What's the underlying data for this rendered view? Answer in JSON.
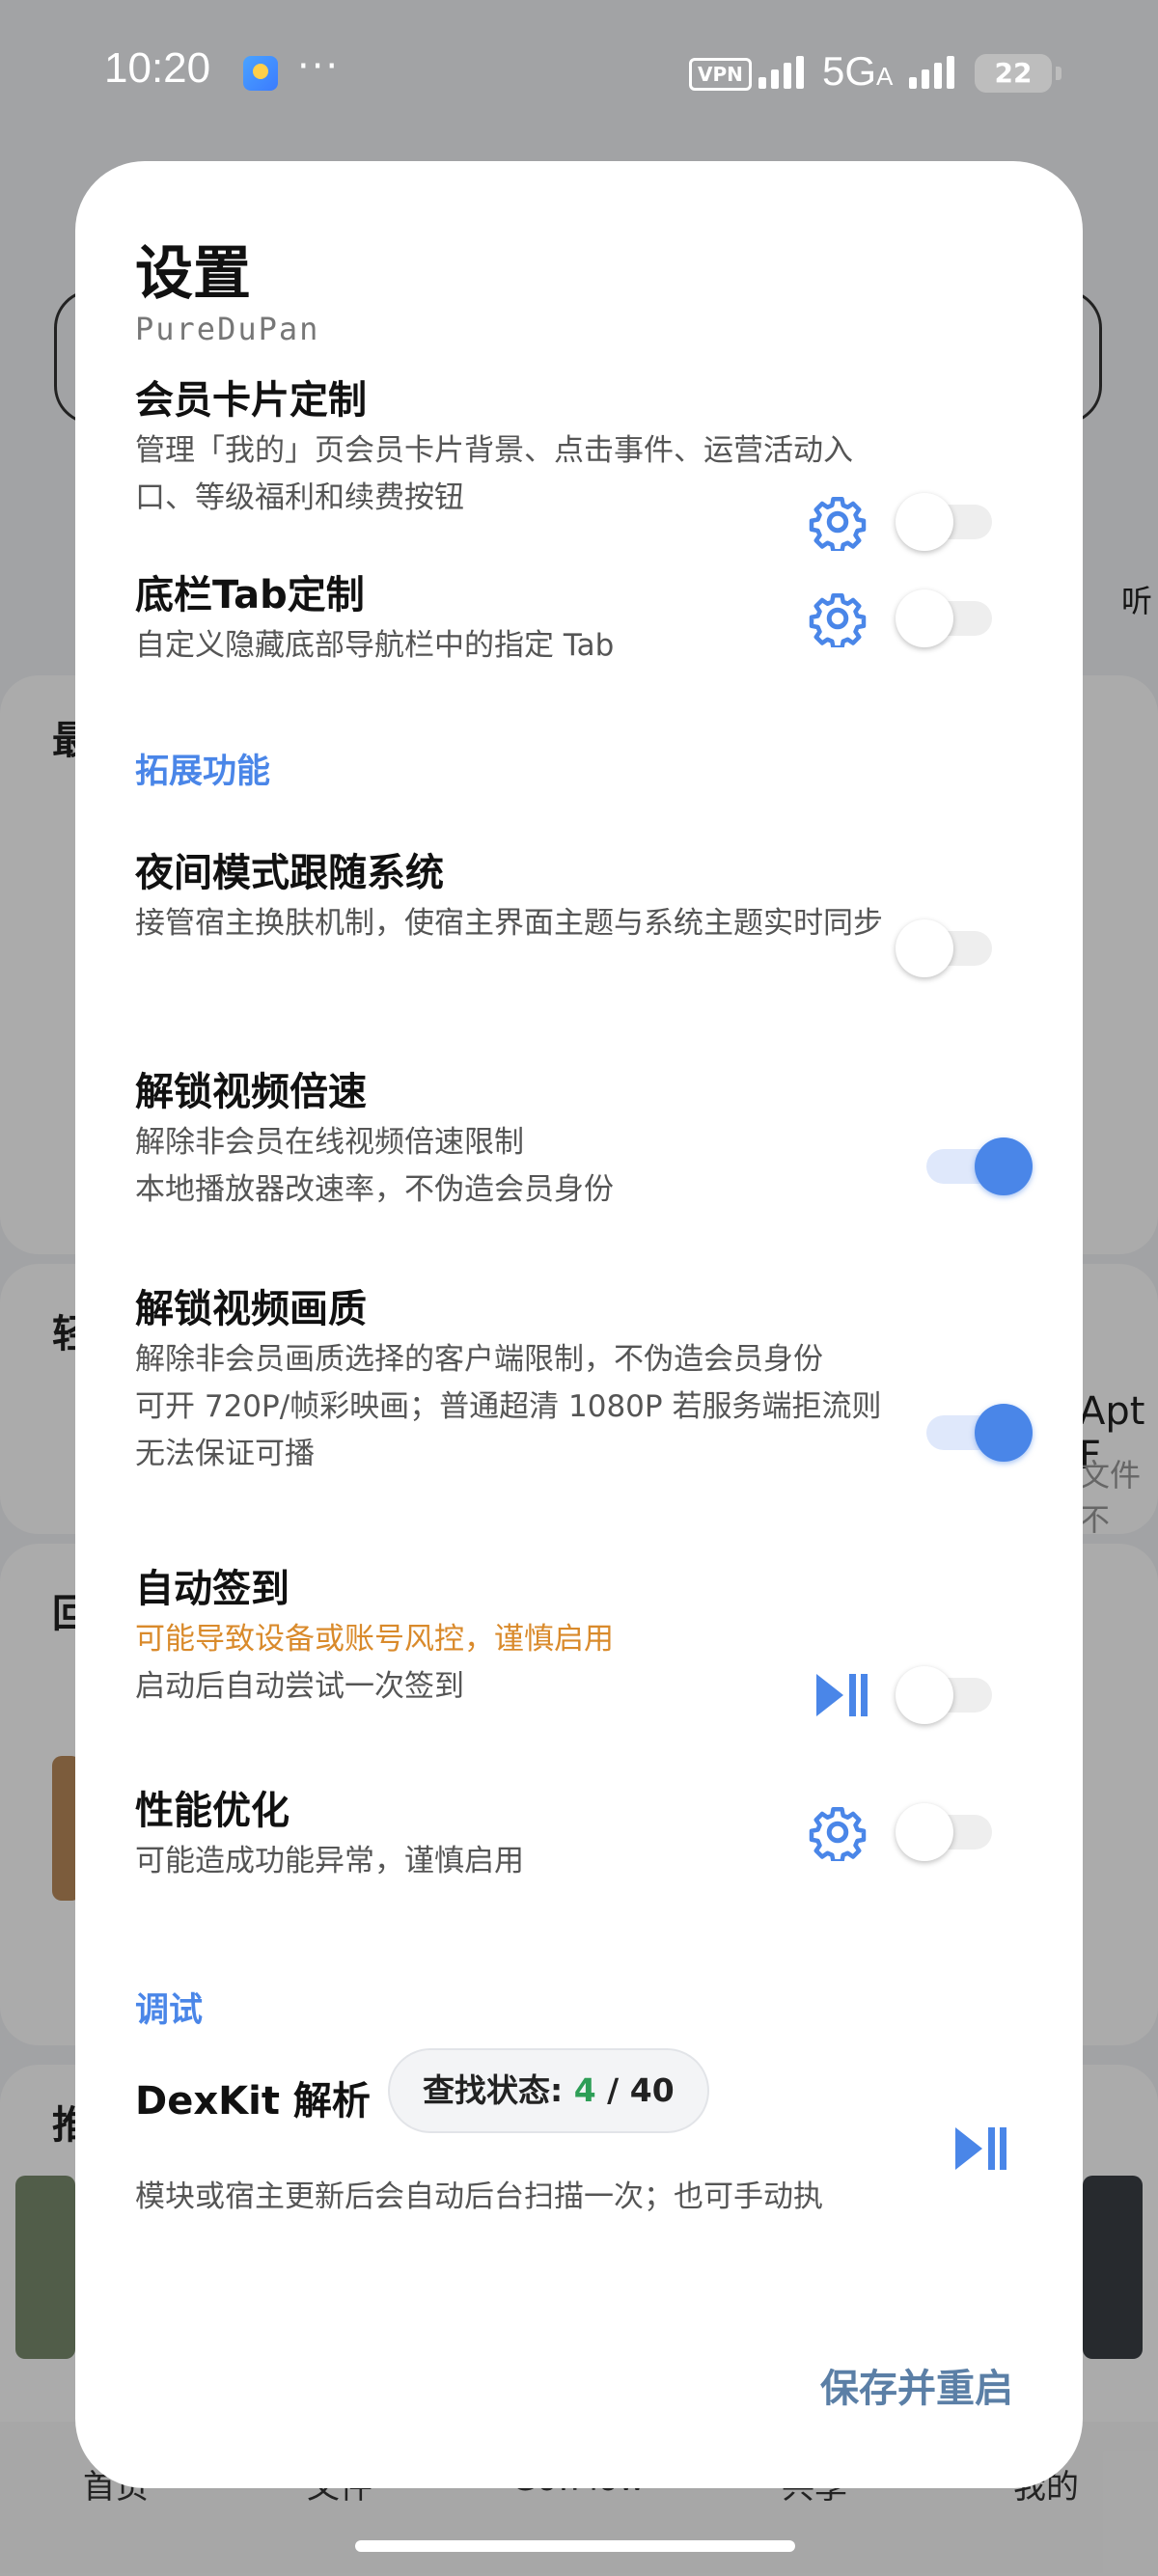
{
  "status_bar": {
    "time": "10:20",
    "dots": "···",
    "vpn": "VPN",
    "network": "5G",
    "network_sub": "A",
    "battery": "22"
  },
  "background_app": {
    "labels": [
      "最",
      "轻",
      "回",
      "推"
    ],
    "right_labels": [
      "听",
      "Apt F",
      "文件不"
    ],
    "bottom_nav": [
      "首页",
      "文件",
      "Go!Flow",
      "共享",
      "我的"
    ]
  },
  "dialog": {
    "title": "设置",
    "subtitle": "PureDuPan",
    "items": [
      {
        "title": "会员卡片定制",
        "desc": "管理「我的」页会员卡片背景、点击事件、运营活动入口、等级福利和续费按钮",
        "control_icon": "gear-icon",
        "enabled": false
      },
      {
        "title": "底栏Tab定制",
        "desc": "自定义隐藏底部导航栏中的指定 Tab",
        "control_icon": "gear-icon",
        "enabled": false
      }
    ],
    "section_extend": "拓展功能",
    "extend_items": [
      {
        "title": "夜间模式跟随系统",
        "desc": "接管宿主换肤机制，使宿主界面主题与系统主题实时同步",
        "enabled": false
      },
      {
        "title": "解锁视频倍速",
        "desc1": "解除非会员在线视频倍速限制",
        "desc2": "本地播放器改速率，不伪造会员身份",
        "enabled": true
      },
      {
        "title": "解锁视频画质",
        "desc1": "解除非会员画质选择的客户端限制，不伪造会员身份",
        "desc2": "可开 720P/帧彩映画；普通超清 1080P 若服务端拒流则无法保证可播",
        "enabled": true
      },
      {
        "title": "自动签到",
        "warning": "可能导致设备或账号风控，谨慎启用",
        "desc": "启动后自动尝试一次签到",
        "control_icon": "play-pause-icon",
        "enabled": false
      },
      {
        "title": "性能优化",
        "desc": "可能造成功能异常，谨慎启用",
        "control_icon": "gear-icon",
        "enabled": false
      }
    ],
    "section_debug": "调试",
    "dexkit": {
      "title": "DexKit 解析",
      "status_label": "查找状态:",
      "found": "4",
      "separator": "/",
      "total": "40",
      "desc": "模块或宿主更新后会自动后台扫描一次；也可手动执",
      "control_icon": "play-pause-icon"
    },
    "save_button": "保存并重启"
  },
  "colors": {
    "accent": "#4a86e8",
    "warning": "#d98a2b",
    "found_green": "#2e9e57"
  }
}
